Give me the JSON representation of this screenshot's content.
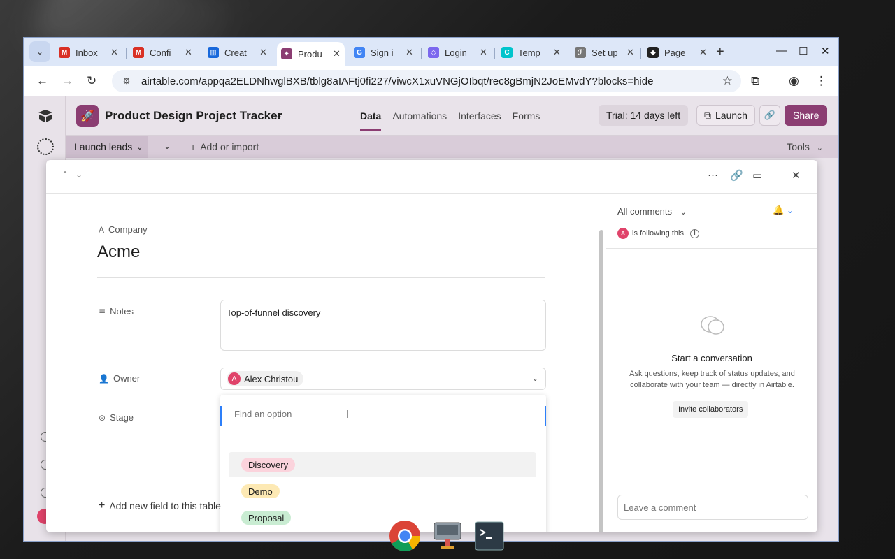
{
  "browser": {
    "tabs": [
      {
        "label": "Inbox",
        "icon": "gmail-icon",
        "color": "#d93025",
        "glyph": "M"
      },
      {
        "label": "Confi",
        "icon": "gmail-icon",
        "color": "#d93025",
        "glyph": "M"
      },
      {
        "label": "Creat",
        "icon": "trello-icon",
        "color": "#1868db",
        "glyph": "▥"
      },
      {
        "label": "Produ",
        "icon": "airtable-icon",
        "color": "#8b3d72",
        "glyph": "✦"
      },
      {
        "label": "Sign i",
        "icon": "google-icon",
        "color": "#4285f4",
        "glyph": "G"
      },
      {
        "label": "Login",
        "icon": "clickup-icon",
        "color": "#7b68ee",
        "glyph": "◇"
      },
      {
        "label": "Temp",
        "icon": "canva-icon",
        "color": "#00c4cc",
        "glyph": "C"
      },
      {
        "label": "Set up",
        "icon": "zapier-icon",
        "color": "#777777",
        "glyph": "ℱ"
      },
      {
        "label": "Page",
        "icon": "generic-page-icon",
        "color": "#222222",
        "glyph": "◆"
      }
    ],
    "url": "airtable.com/appqa2ELDNhwglBXB/tblg8aIAFtj0fi227/viwcX1xuVNGjOIbqt/rec8gBmjN2JoEMvdY?blocks=hide"
  },
  "app": {
    "base_title": "Product Design Project Tracker",
    "nav": [
      "Data",
      "Automations",
      "Interfaces",
      "Forms"
    ],
    "trial": "Trial: 14 days left",
    "launch": "Launch",
    "share": "Share",
    "table_tab": "Launch leads",
    "add_import": "Add or import",
    "tools": "Tools"
  },
  "record": {
    "primary_label": "Company",
    "primary_value": "Acme",
    "notes_label": "Notes",
    "notes_value": "Top-of-funnel discovery",
    "owner_label": "Owner",
    "owner_value": "Alex Christou",
    "owner_initial": "A",
    "stage_label": "Stage",
    "find_placeholder": "Find an option",
    "options": [
      {
        "label": "Discovery",
        "color": "#fbd3dc"
      },
      {
        "label": "Demo",
        "color": "#fde9b4"
      },
      {
        "label": "Proposal",
        "color": "#c9ecd2"
      }
    ],
    "add_field": "Add new field to this table"
  },
  "comments": {
    "filter": "All comments",
    "following": "is following this.",
    "initial": "A",
    "empty_title": "Start a conversation",
    "empty_desc": "Ask questions, keep track of status updates, and collaborate with your team — directly in Airtable.",
    "invite": "Invite collaborators",
    "input_placeholder": "Leave a comment"
  }
}
